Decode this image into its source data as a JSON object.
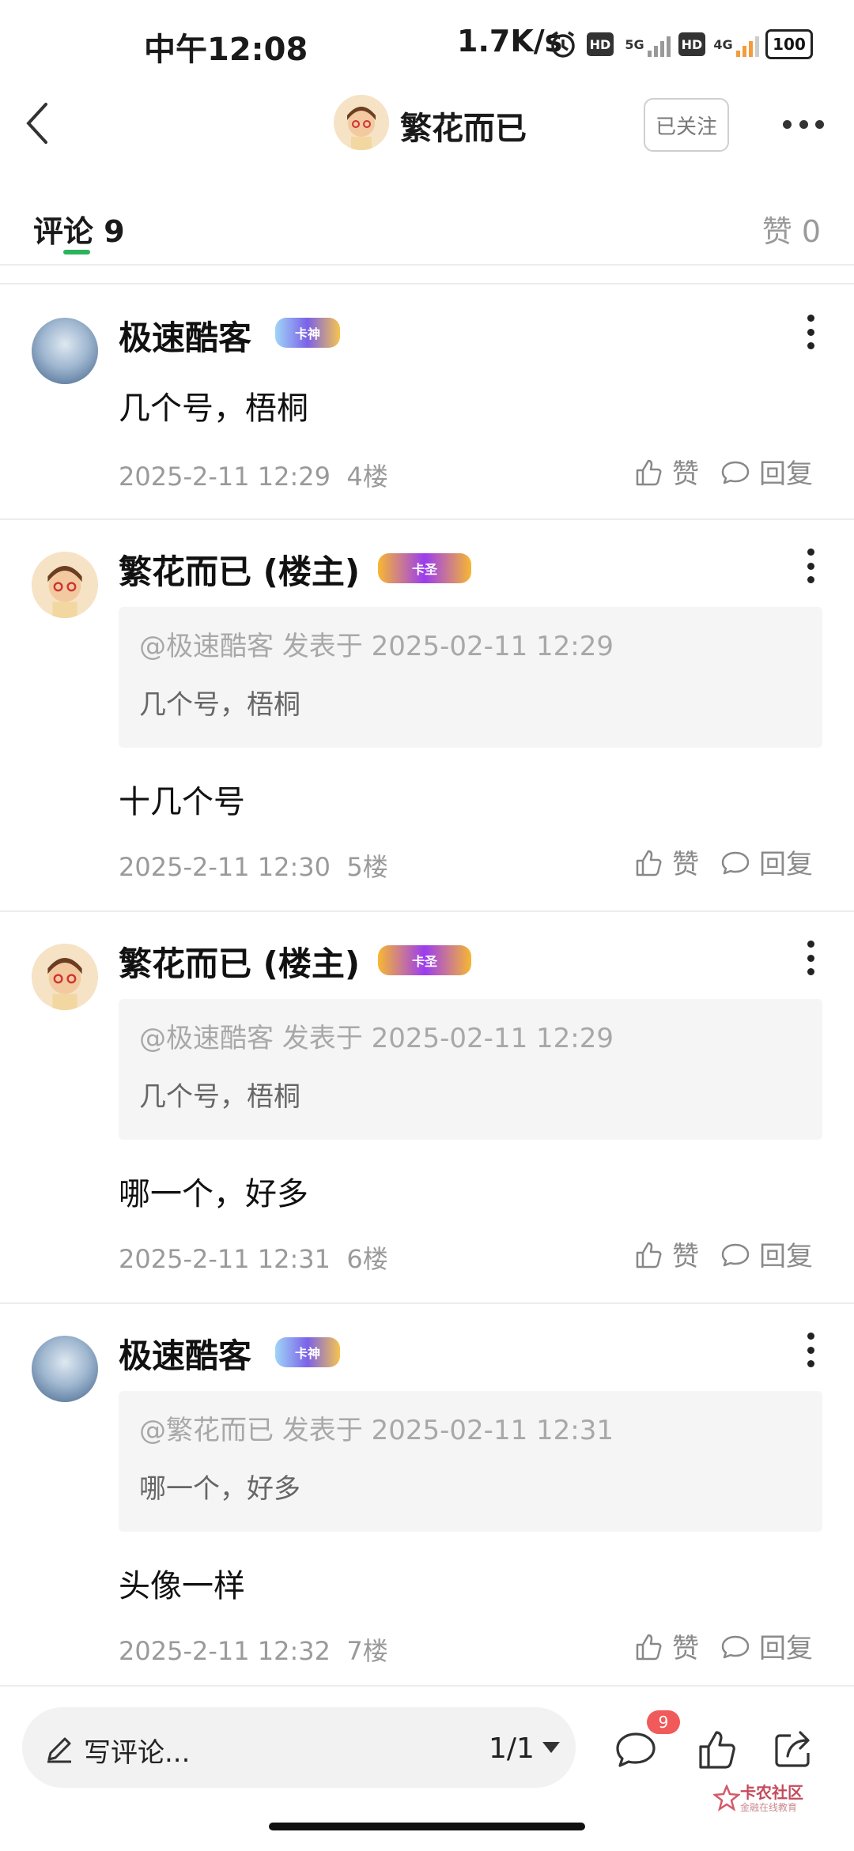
{
  "status_bar": {
    "time": "中午12:08",
    "speed": "1.7K/s",
    "hd1": "HD",
    "net1": "5G",
    "hd2": "HD",
    "net2": "4G",
    "battery": "100"
  },
  "header": {
    "title": "繁花而已",
    "follow_label": "已关注"
  },
  "tabs": {
    "comments_label": "评论",
    "comments_count": "9",
    "likes_label": "赞",
    "likes_count": "0"
  },
  "comments": [
    {
      "author": "极速酷客",
      "badge": "卡神",
      "text": "几个号，梧桐",
      "time": "2025-2-11 12:29",
      "floor": "4楼",
      "like_label": "赞",
      "reply_label": "回复"
    },
    {
      "author": "繁花而已 (楼主)",
      "badge": "卡圣",
      "quote_meta": "@极速酷客 发表于 2025-02-11 12:29",
      "quote_text": "几个号，梧桐",
      "text": "十几个号",
      "time": "2025-2-11 12:30",
      "floor": "5楼",
      "like_label": "赞",
      "reply_label": "回复"
    },
    {
      "author": "繁花而已 (楼主)",
      "badge": "卡圣",
      "quote_meta": "@极速酷客 发表于 2025-02-11 12:29",
      "quote_text": "几个号，梧桐",
      "text": "哪一个，好多",
      "time": "2025-2-11 12:31",
      "floor": "6楼",
      "like_label": "赞",
      "reply_label": "回复"
    },
    {
      "author": "极速酷客",
      "badge": "卡神",
      "quote_meta": "@繁花而已 发表于 2025-02-11 12:31",
      "quote_text": "哪一个，好多",
      "text": "头像一样",
      "time": "2025-2-11 12:32",
      "floor": "7楼",
      "like_label": "赞",
      "reply_label": "回复"
    }
  ],
  "bottom_bar": {
    "comment_placeholder": "写评论...",
    "page_indicator": "1/1",
    "comment_count_badge": "9"
  },
  "watermark": {
    "text": "卡农社区",
    "subtext": "金融在线教育"
  },
  "icons": {
    "back": "chevron-left-icon",
    "more": "more-horizontal-icon",
    "kebab": "more-vertical-icon",
    "like": "thumbs-up-icon",
    "reply": "comment-bubble-icon",
    "pencil": "pencil-icon",
    "share": "share-icon"
  },
  "colors": {
    "accent_green": "#2bb35c",
    "badge_red": "#f05a5a",
    "quote_bg": "#f5f5f5"
  }
}
